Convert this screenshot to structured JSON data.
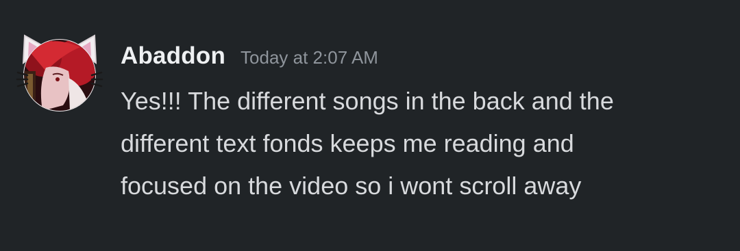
{
  "message": {
    "author": "Abaddon",
    "timestamp": "Today at 2:07 AM",
    "lines": [
      "Yes!!! The different songs in the back and the",
      "different text fonds keeps me reading and",
      "focused on the video so i wont scroll away"
    ]
  },
  "colors": {
    "background": "#202427",
    "username": "#eef0f2",
    "timestamp": "#8f959c",
    "text": "#d8dadd",
    "avatar_accent": "#c61f2b"
  }
}
